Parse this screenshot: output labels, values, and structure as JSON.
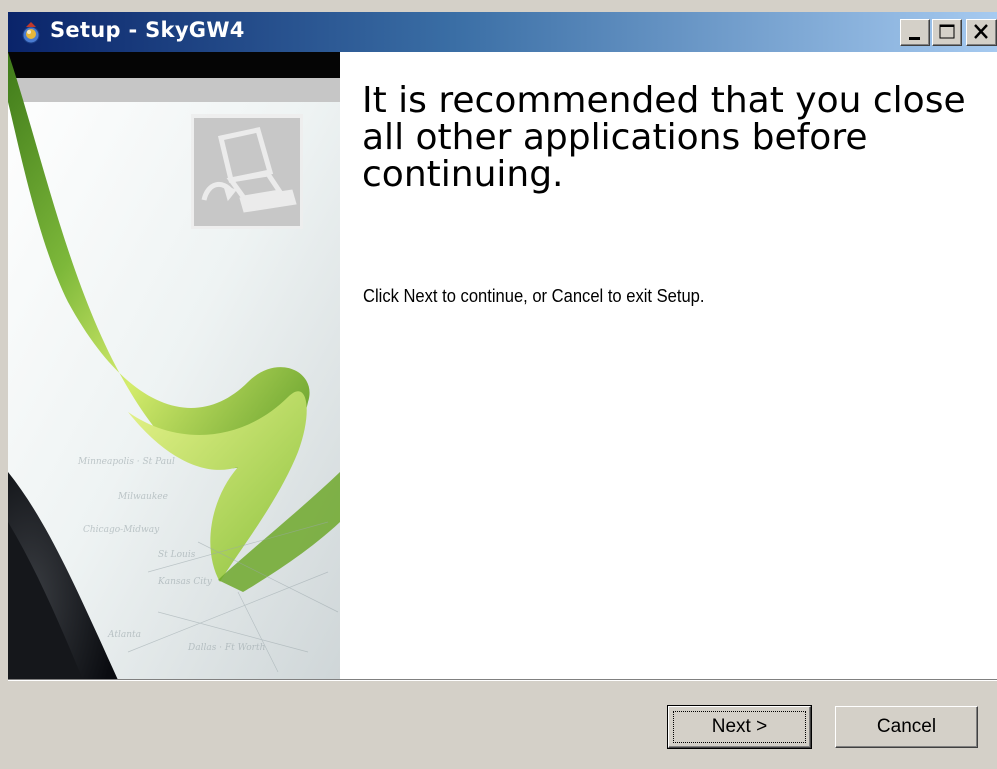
{
  "window": {
    "title": "Setup - SkyGW4"
  },
  "icons": {
    "app": "setup-icon",
    "minimize": "minimize-icon",
    "maximize": "maximize-icon",
    "close": "close-icon",
    "computer": "computer-icon"
  },
  "main": {
    "heading": "It is recommended that you close all other applications before continuing.",
    "instruction": "Click Next to continue, or Cancel to exit Setup."
  },
  "buttons": {
    "next": "Next >",
    "cancel": "Cancel"
  },
  "colors": {
    "title_gradient_start": "#0a246a",
    "title_gradient_end": "#a6caf0",
    "face": "#d4d0c8",
    "ribbon_green": "#6fa52a",
    "ribbon_yellow": "#d7ec6a"
  }
}
